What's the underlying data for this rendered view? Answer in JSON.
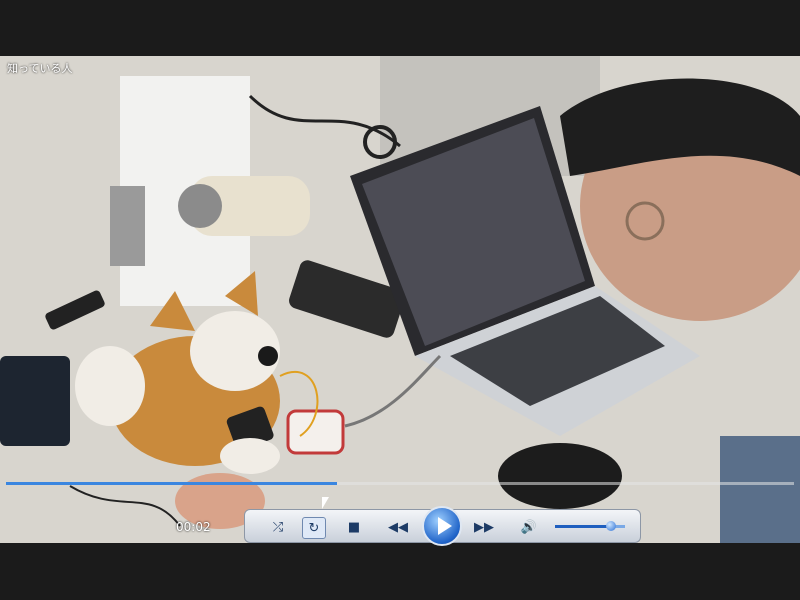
{
  "video": {
    "title": "知っている人",
    "time": "00:02",
    "progress": 0.42
  },
  "controls": {
    "shuffle_icon": "shuffle-icon",
    "repeat_icon": "repeat-icon",
    "stop_icon": "stop-icon",
    "rewind_icon": "rewind-icon",
    "play_icon": "play-icon",
    "forward_icon": "fast-forward-icon",
    "volume_icon": "volume-icon",
    "volume_level": 0.8
  },
  "colors": {
    "seek_fill": "#3a86e0",
    "control_accent": "#1f63c8"
  }
}
